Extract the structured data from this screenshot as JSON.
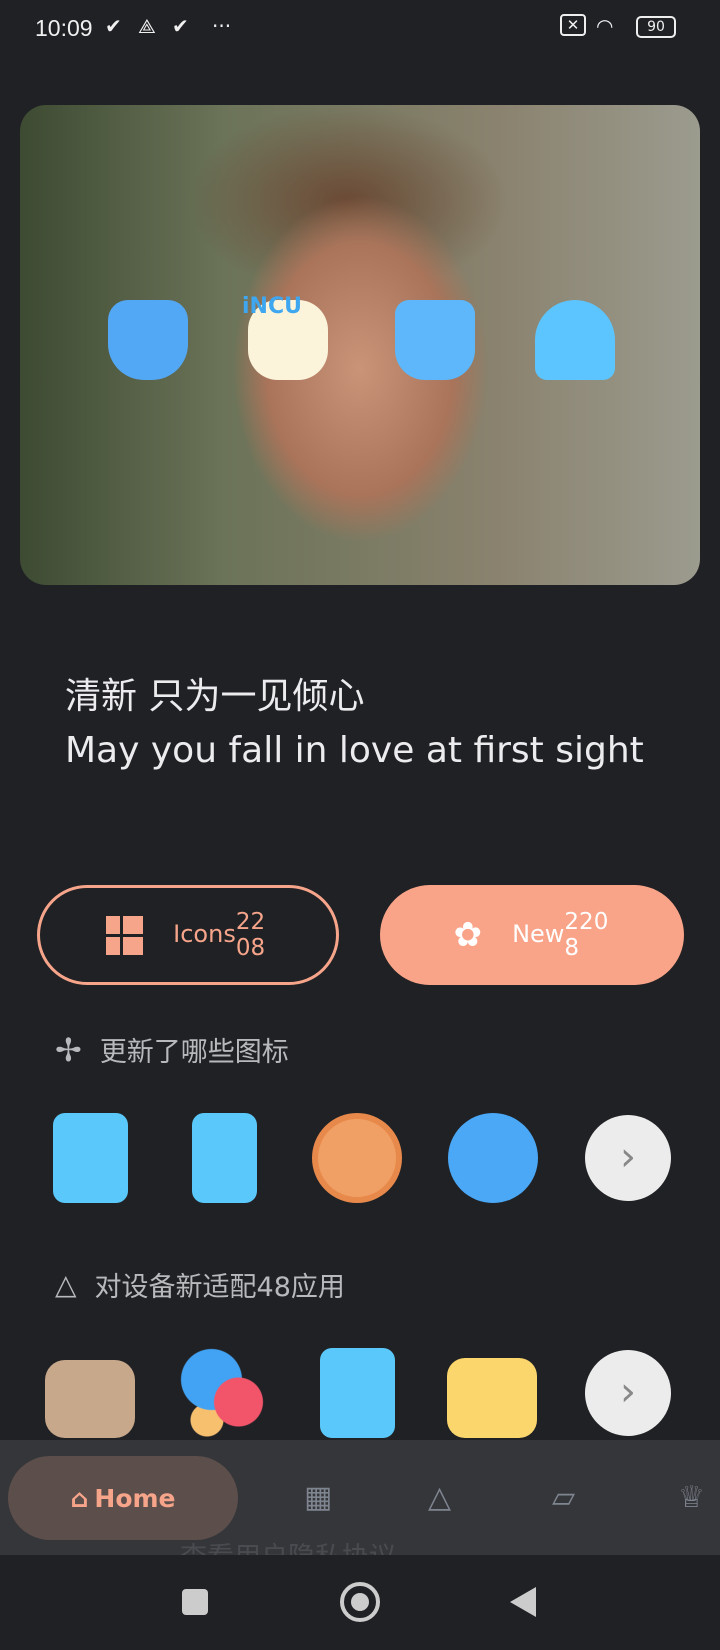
{
  "status_bar": {
    "time": "10:09",
    "battery": "90",
    "icons": [
      "check-icon",
      "drive-icon",
      "check-icon",
      "more-dots-icon",
      "sim-off-icon",
      "wifi-icon",
      "battery-icon"
    ]
  },
  "hero": {
    "icons": [
      "usb-icon",
      "incu-icon",
      "lock-user-icon",
      "headphones-icon"
    ],
    "incu_label": "iNCU"
  },
  "headline": {
    "zh": "清新 只为一见倾心",
    "en": "May you fall in love at first sight"
  },
  "buttons": {
    "icons": {
      "label": "Icons",
      "count": "2208"
    },
    "new": {
      "label": "New",
      "count": "2208"
    }
  },
  "section_updated": {
    "title": "更新了哪些图标",
    "icons": [
      "calculator-icon",
      "phone-icon",
      "clock-icon",
      "planet-icon"
    ]
  },
  "section_adapted": {
    "title": "对设备新适配48应用",
    "icons": [
      "amazon-icon",
      "bubbles-icon",
      "calculator-icon",
      "calendar-icon"
    ]
  },
  "nav": {
    "home": "Home",
    "items": [
      "icons-tab",
      "shapes-tab",
      "cards-tab",
      "trophy-tab"
    ],
    "behind_text": "查看用户隐私协议"
  },
  "colors": {
    "accent": "#f9a488",
    "background": "#202125",
    "nav": "#35363a"
  }
}
